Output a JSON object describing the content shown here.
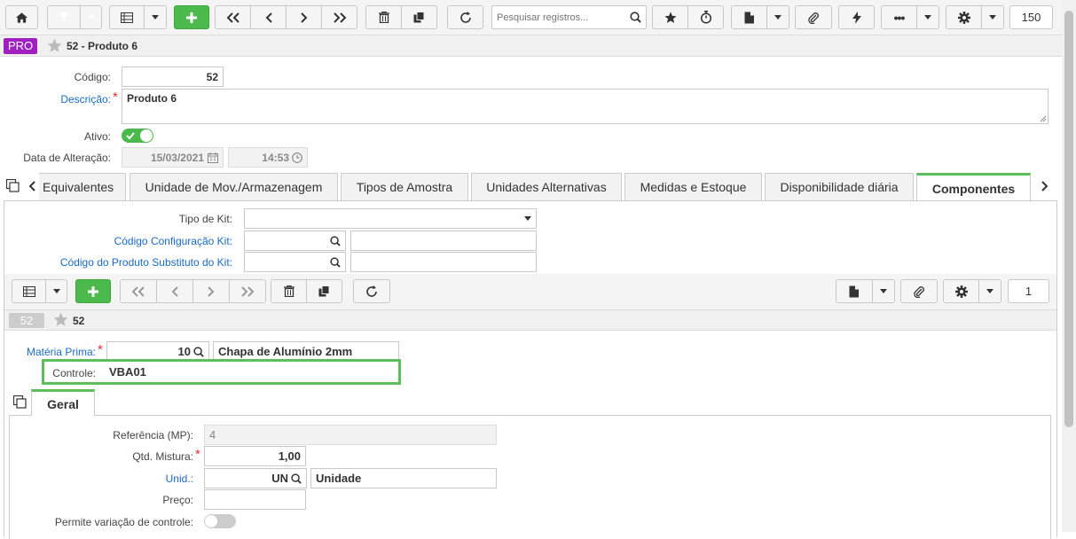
{
  "toolbar": {
    "search_placeholder": "Pesquisar registros...",
    "page_size": "150"
  },
  "header": {
    "badge": "PRO",
    "title": "52 - Produto 6"
  },
  "form": {
    "codigo_label": "Código:",
    "codigo_value": "52",
    "descricao_label": "Descrição:",
    "descricao_value": "Produto 6",
    "ativo_label": "Ativo:",
    "data_label": "Data de Alteração:",
    "data_value": "15/03/2021",
    "hora_value": "14:53"
  },
  "tabs": [
    "Equivalentes",
    "Unidade de Mov./Armazenagem",
    "Tipos de Amostra",
    "Unidades Alternativas",
    "Medidas e Estoque",
    "Disponibilidade diária",
    "Componentes"
  ],
  "componentes": {
    "tipo_kit_label": "Tipo de Kit:",
    "cod_config_label": "Código Configuração Kit:",
    "cod_subst_label": "Código do Produto Substituto do Kit:",
    "page_size": "1",
    "record_badge": "52",
    "record_title": "52",
    "materia_label": "Matéria Prima:",
    "materia_code": "10",
    "materia_desc": "Chapa de Alumínio 2mm",
    "controle_label": "Controle:",
    "controle_value": "VBA01",
    "subtab": "Geral",
    "ref_label": "Referência (MP):",
    "ref_value": "4",
    "qtd_label": "Qtd. Mistura:",
    "qtd_value": "1,00",
    "unid_label": "Unid.:",
    "unid_code": "UN",
    "unid_desc": "Unidade",
    "preco_label": "Preço:",
    "permite_label": "Permite variação de controle:"
  },
  "colors": {
    "accent_green": "#4cb94c",
    "badge_purple": "#a020c0",
    "link_blue": "#1a6bc4",
    "highlight": "#5cbf5c"
  }
}
